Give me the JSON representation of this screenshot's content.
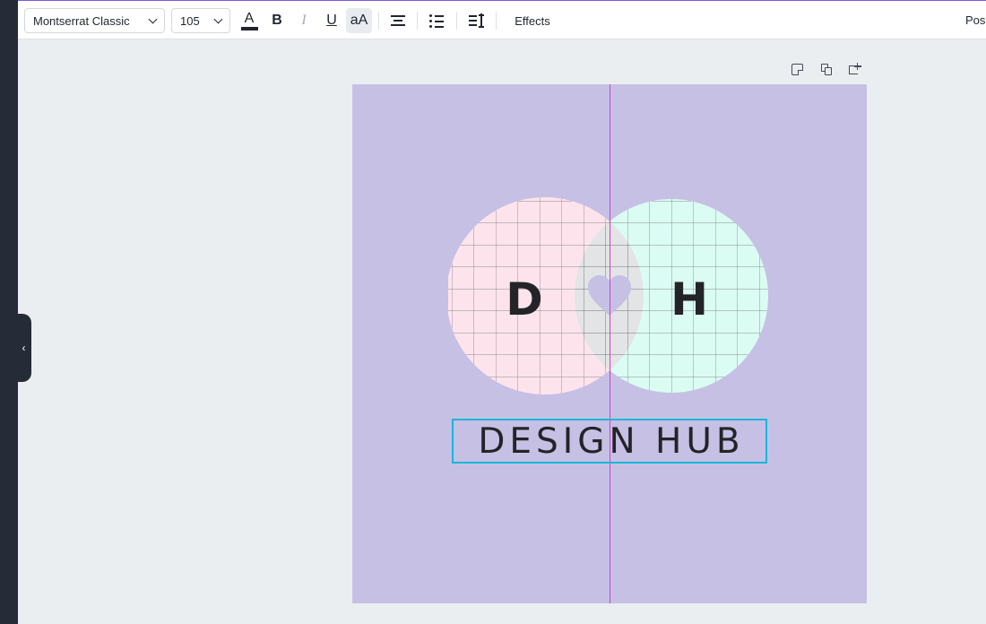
{
  "toolbar": {
    "font_family": "Montserrat Classic",
    "font_size": "105",
    "text_color_label": "A",
    "bold_label": "B",
    "italic_label": "I",
    "underline_label": "U",
    "case_label": "aA",
    "effects_label": "Effects",
    "position_label": "Position"
  },
  "design": {
    "left_letter": "D",
    "right_letter": "H",
    "title": "DESIGN HUB",
    "background_color": "#c6c0e5",
    "left_circle_color": "#fde4ec",
    "right_circle_color": "#dbfcf3",
    "overlap_color": "#e3e4e6"
  },
  "sidebar": {
    "collapse_label": "‹"
  }
}
